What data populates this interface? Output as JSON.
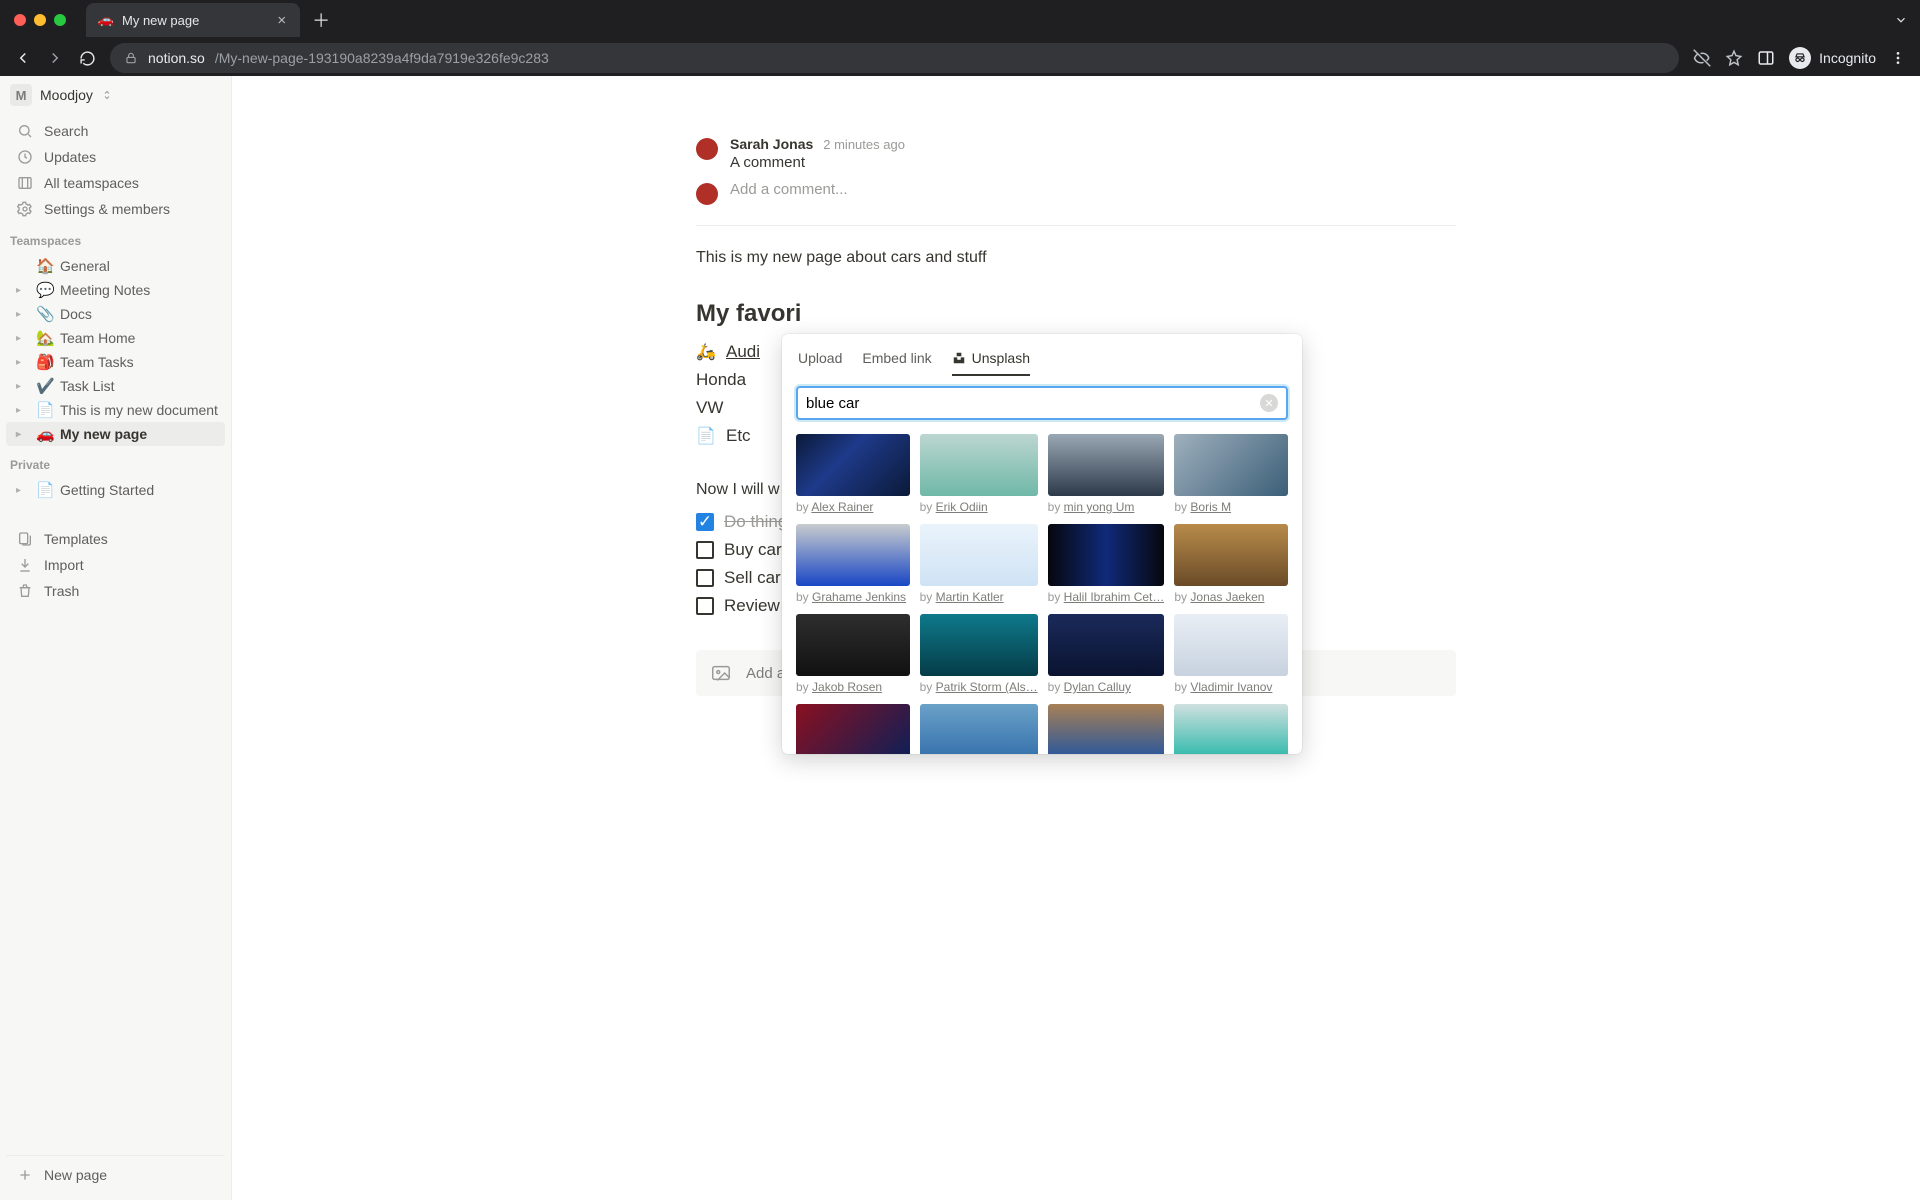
{
  "browser": {
    "tab_title": "My new page",
    "tab_fav": "🚗",
    "url_domain": "notion.so",
    "url_path": "/My-new-page-193190a8239a4f9da7919e326fe9c283",
    "incognito_label": "Incognito"
  },
  "workspace": {
    "initial": "M",
    "name": "Moodjoy"
  },
  "sidebar_top": [
    {
      "label": "Search"
    },
    {
      "label": "Updates"
    },
    {
      "label": "All teamspaces"
    },
    {
      "label": "Settings & members"
    }
  ],
  "sidebar": {
    "teamspaces_heading": "Teamspaces",
    "teamspaces": [
      {
        "emoji": "🏠",
        "label": "General",
        "caret": false
      },
      {
        "emoji": "💬",
        "label": "Meeting Notes",
        "caret": true
      },
      {
        "emoji": "📎",
        "label": "Docs",
        "caret": true
      },
      {
        "emoji": "🏡",
        "label": "Team Home",
        "caret": true
      },
      {
        "emoji": "🎒",
        "label": "Team Tasks",
        "caret": true
      },
      {
        "emoji": "✔️",
        "label": "Task List",
        "caret": true
      },
      {
        "emoji": "📄",
        "label": "This is my new document",
        "caret": true
      },
      {
        "emoji": "🚗",
        "label": "My new page",
        "caret": true,
        "active": true
      }
    ],
    "private_heading": "Private",
    "private": [
      {
        "emoji": "📄",
        "label": "Getting Started",
        "caret": true
      }
    ],
    "utility": [
      {
        "label": "Templates"
      },
      {
        "label": "Import"
      },
      {
        "label": "Trash"
      }
    ],
    "new_page_label": "New page"
  },
  "page": {
    "comment": {
      "author": "Sarah Jonas",
      "time": "2 minutes ago",
      "body": "A comment",
      "add_placeholder": "Add a comment..."
    },
    "intro": "This is my new page about cars and stuff",
    "h_fav": "My favori",
    "car_rows": [
      {
        "icon": "🛵",
        "text": "Audi",
        "link": true
      },
      {
        "icon": "",
        "text": "Honda"
      },
      {
        "icon": "",
        "text": "VW"
      },
      {
        "icon": "📄",
        "text": "Etc"
      }
    ],
    "now_line": "Now I will w",
    "todos": [
      {
        "done": true,
        "text": "Do thing"
      },
      {
        "done": false,
        "text": "Buy car"
      },
      {
        "done": false,
        "text": "Sell car"
      },
      {
        "done": false,
        "text": "Review"
      }
    ],
    "image_block_label": "Add an image"
  },
  "popover": {
    "tabs": {
      "upload": "Upload",
      "embed": "Embed link",
      "unsplash": "Unsplash"
    },
    "search_value": "blue car",
    "credit_prefix": "by ",
    "results": [
      {
        "author": "Alex Rainer",
        "thumb": "thumb-a"
      },
      {
        "author": "Erik Odiin",
        "thumb": "thumb-b"
      },
      {
        "author": "min yong Um",
        "thumb": "thumb-c"
      },
      {
        "author": "Boris M",
        "thumb": "thumb-d"
      },
      {
        "author": "Grahame Jenkins",
        "thumb": "thumb-e"
      },
      {
        "author": "Martin Katler",
        "thumb": "thumb-f"
      },
      {
        "author": "Halil Ibrahim Cet…",
        "thumb": "thumb-g"
      },
      {
        "author": "Jonas Jaeken",
        "thumb": "thumb-h"
      },
      {
        "author": "Jakob Rosen",
        "thumb": "thumb-i"
      },
      {
        "author": "Patrik Storm (Als…",
        "thumb": "thumb-j"
      },
      {
        "author": "Dylan Calluy",
        "thumb": "thumb-k"
      },
      {
        "author": "Vladimir Ivanov",
        "thumb": "thumb-l"
      },
      {
        "author": "",
        "thumb": "thumb-m"
      },
      {
        "author": "",
        "thumb": "thumb-n"
      },
      {
        "author": "",
        "thumb": "thumb-o"
      },
      {
        "author": "",
        "thumb": "thumb-p"
      }
    ]
  }
}
